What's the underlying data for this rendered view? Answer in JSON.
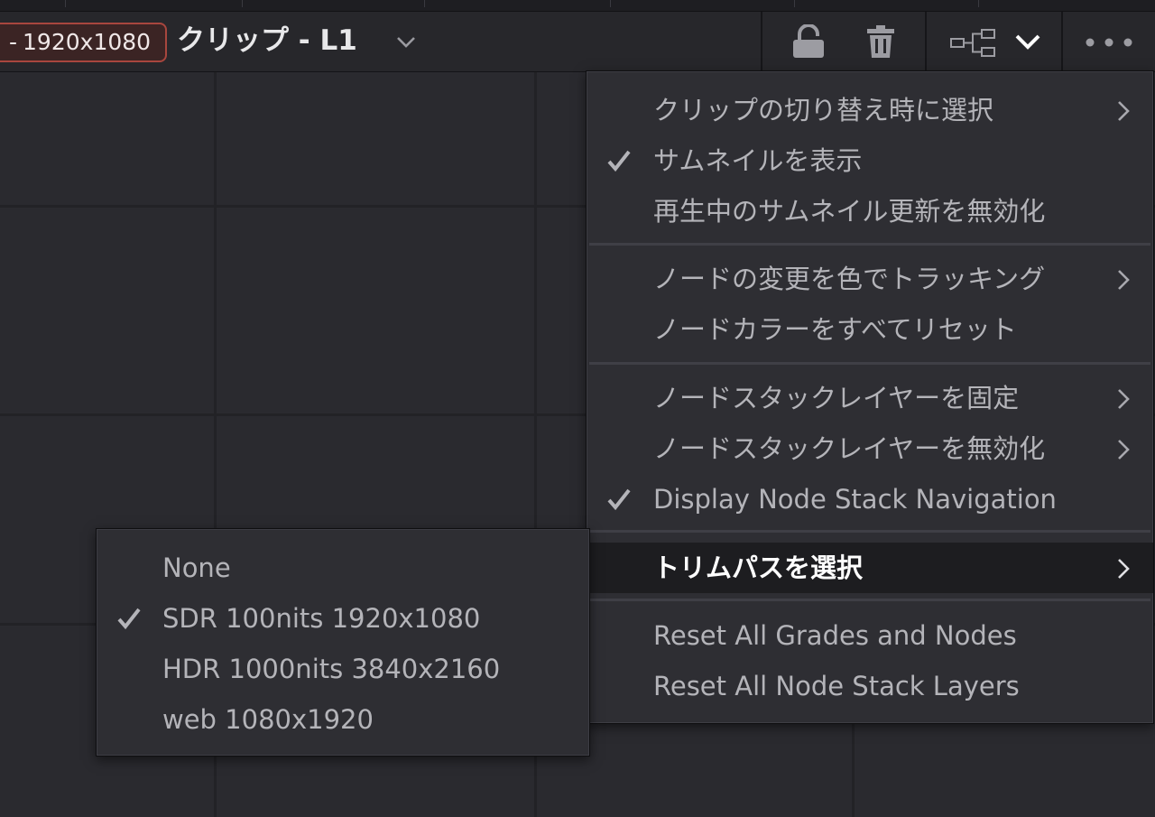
{
  "header": {
    "resolution_badge": "1920x1080",
    "badge_prefix": "-",
    "clip_title": "クリップ  -  L1"
  },
  "icons": {
    "lock": "lock-open-icon",
    "trash": "trash-icon",
    "node_graph": "node-graph-icon",
    "dropdown": "chevron-down-icon",
    "more": "more-options-icon"
  },
  "main_menu": {
    "groups": [
      [
        {
          "label": "クリップの切り替え時に選択",
          "checked": false,
          "submenu": true
        },
        {
          "label": "サムネイルを表示",
          "checked": true,
          "submenu": false
        },
        {
          "label": "再生中のサムネイル更新を無効化",
          "checked": false,
          "submenu": false
        }
      ],
      [
        {
          "label": "ノードの変更を色でトラッキング",
          "checked": false,
          "submenu": true
        },
        {
          "label": "ノードカラーをすべてリセット",
          "checked": false,
          "submenu": false
        }
      ],
      [
        {
          "label": "ノードスタックレイヤーを固定",
          "checked": false,
          "submenu": true
        },
        {
          "label": "ノードスタックレイヤーを無効化",
          "checked": false,
          "submenu": true
        },
        {
          "label": "Display Node Stack Navigation",
          "checked": true,
          "submenu": false
        }
      ],
      [
        {
          "label": "トリムパスを選択",
          "checked": false,
          "submenu": true,
          "highlighted": true
        }
      ],
      [
        {
          "label": "Reset All Grades and Nodes",
          "checked": false,
          "submenu": false
        },
        {
          "label": "Reset All Node Stack Layers",
          "checked": false,
          "submenu": false
        }
      ]
    ]
  },
  "trim_submenu": {
    "items": [
      {
        "label": "None",
        "checked": false
      },
      {
        "label": "SDR 100nits 1920x1080",
        "checked": true
      },
      {
        "label": "HDR 1000nits 3840x2160",
        "checked": false
      },
      {
        "label": "web 1080x1920",
        "checked": false
      }
    ]
  },
  "colors": {
    "badge_border": "#a8463e",
    "menu_bg": "#2e2e33",
    "highlight_bg": "#1d1d20",
    "menu_text": "#b4b4b9"
  }
}
